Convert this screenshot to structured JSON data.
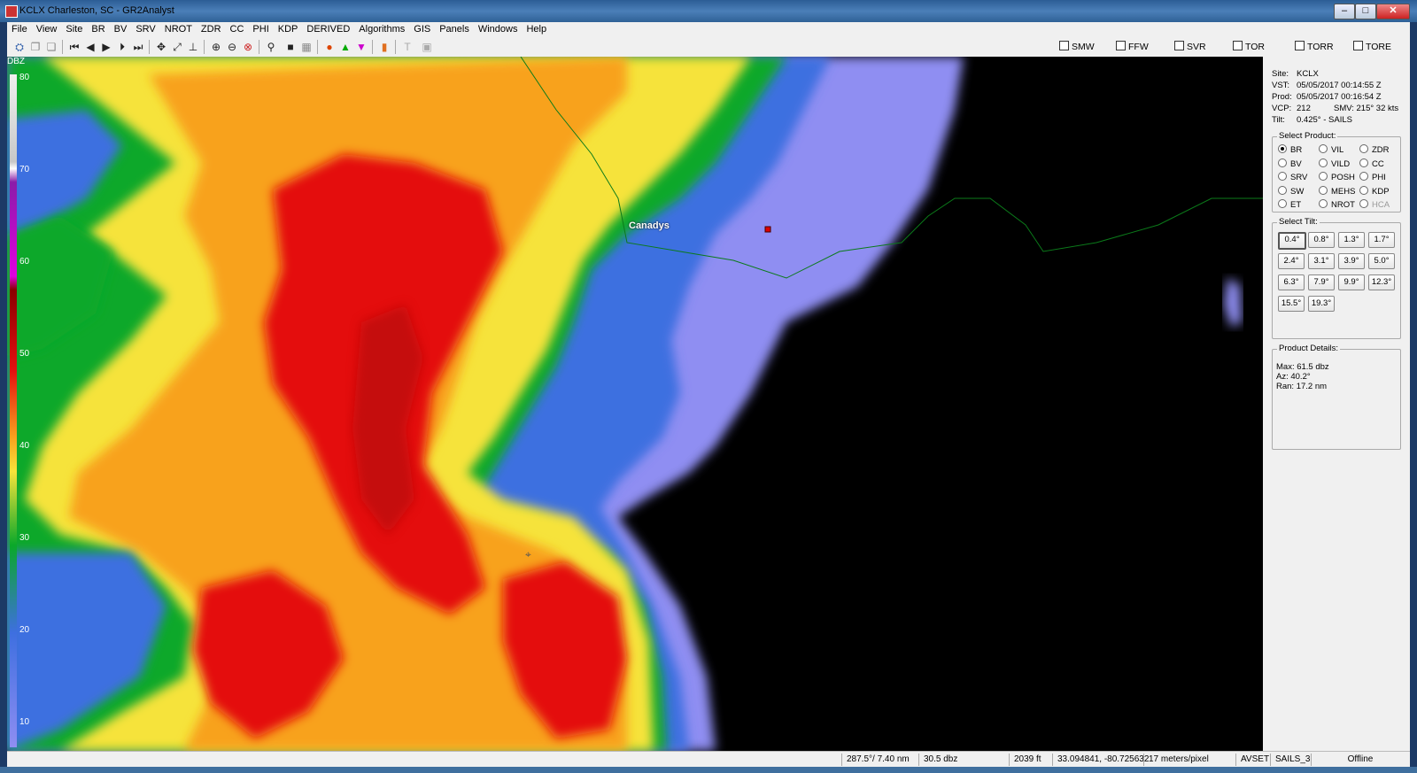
{
  "window": {
    "title": "KCLX Charleston, SC - GR2Analyst"
  },
  "menu": [
    "File",
    "View",
    "Site",
    "BR",
    "BV",
    "SRV",
    "NROT",
    "ZDR",
    "CC",
    "PHI",
    "KDP",
    "DERIVED",
    "Algorithms",
    "GIS",
    "Panels",
    "Windows",
    "Help"
  ],
  "warnings": [
    "SMW",
    "FFW",
    "SVR",
    "TOR",
    "TORR",
    "TORE"
  ],
  "legend": {
    "unit": "DBZ",
    "ticks": [
      "80",
      "70",
      "60",
      "50",
      "40",
      "30",
      "20",
      "10"
    ]
  },
  "map": {
    "place_label": "Canadys"
  },
  "info": {
    "site_label": "Site:",
    "site": "KCLX",
    "vst_label": "VST:",
    "vst": "05/05/2017  00:14:55 Z",
    "prod_label": "Prod:",
    "prod": "05/05/2017  00:16:54 Z",
    "vcp_label": "VCP:",
    "vcp": "212",
    "smv": "SMV:  215° 32 kts",
    "tilt_label": "Tilt:",
    "tilt": "0.425° - SAILS"
  },
  "select_product": {
    "label": "Select Product:",
    "products": [
      "BR",
      "VIL",
      "ZDR",
      "BV",
      "VILD",
      "CC",
      "SRV",
      "POSH",
      "PHI",
      "SW",
      "MEHS",
      "KDP",
      "ET",
      "NROT",
      "HCA"
    ],
    "selected": "BR",
    "disabled": [
      "HCA"
    ]
  },
  "select_tilt": {
    "label": "Select Tilt:",
    "tilts": [
      "0.4°",
      "0.8°",
      "1.3°",
      "1.7°",
      "2.4°",
      "3.1°",
      "3.9°",
      "5.0°",
      "6.3°",
      "7.9°",
      "9.9°",
      "12.3°",
      "15.5°",
      "19.3°"
    ],
    "selected": "0.4°"
  },
  "product_details": {
    "label": "Product Details:",
    "max": "Max:  61.5 dbz",
    "az": "Az:   40.2°",
    "ran": "Ran:  17.2 nm"
  },
  "status": {
    "azran": "287.5°/ 7.40 nm",
    "value": "30.5 dbz",
    "height": "2039 ft",
    "latlon": "33.094841, -80.725632",
    "resolution": "17 meters/pixel",
    "avset": "AVSET",
    "sails": "SAILS_3",
    "connection": "Offline"
  }
}
